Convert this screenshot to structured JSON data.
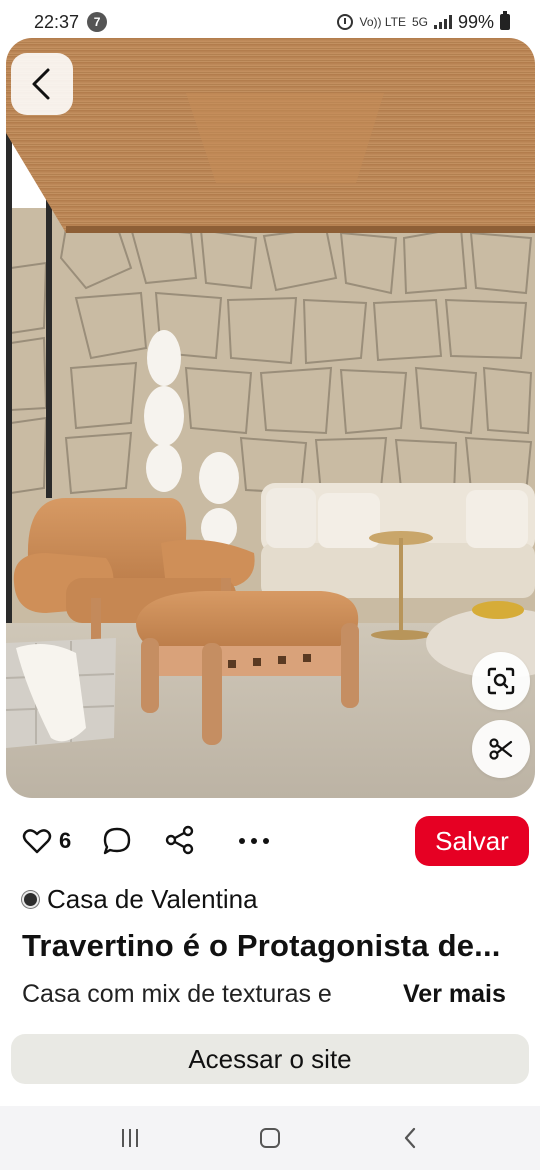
{
  "status_bar": {
    "time": "22:37",
    "notification_count": "7",
    "network_label_1": "Vo)) LTE",
    "network_label_2": "5G",
    "battery": "99%"
  },
  "pin": {
    "likes": "6",
    "save_label": "Salvar",
    "creator_name": "Casa de Valentina",
    "title": "Travertino é o Protagonista de...",
    "description": "Casa com mix de texturas e",
    "see_more_label": "Ver mais",
    "visit_label": "Acessar o site"
  },
  "icons": {
    "back": "chevron-left-icon",
    "lens": "visual-search-icon",
    "cut": "scissors-icon",
    "like": "heart-icon",
    "comment": "comment-icon",
    "share": "share-icon",
    "more": "more-icon"
  },
  "colors": {
    "save_button": "#e60023",
    "visit_button": "#e9e9e4",
    "nav_bar": "#f4f4f6"
  }
}
